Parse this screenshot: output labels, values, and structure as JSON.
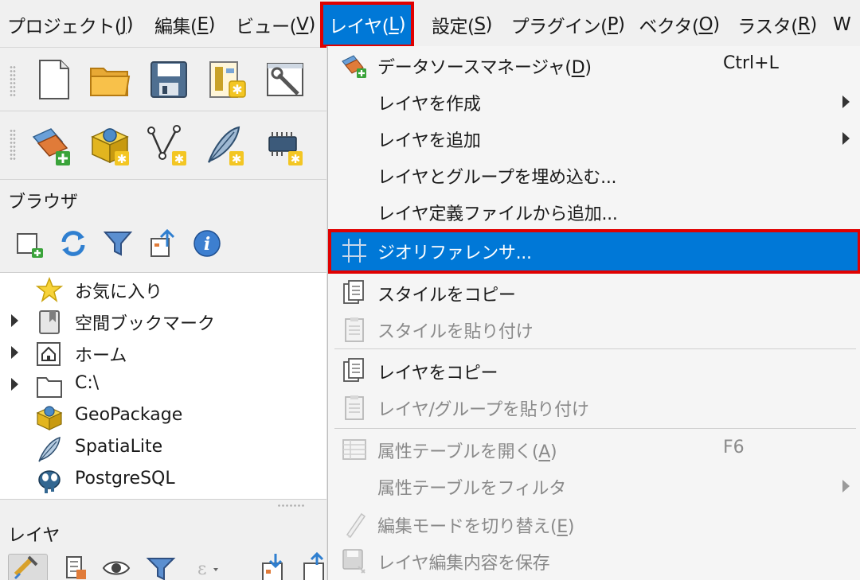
{
  "menubar": {
    "items": [
      {
        "label": "プロジェクト(",
        "accel": "J",
        "close": ")"
      },
      {
        "label": "編集(",
        "accel": "E",
        "close": ")"
      },
      {
        "label": "ビュー(",
        "accel": "V",
        "close": ")"
      },
      {
        "label": "レイヤ(",
        "accel": "L",
        "close": ")"
      },
      {
        "label": "設定(",
        "accel": "S",
        "close": ")"
      },
      {
        "label": "プラグイン(",
        "accel": "P",
        "close": ")"
      },
      {
        "label": "ベクタ(",
        "accel": "O",
        "close": ")"
      },
      {
        "label": "ラスタ(",
        "accel": "R",
        "close": ")"
      },
      {
        "label": "W",
        "accel": "",
        "close": ""
      }
    ],
    "active_index": 3
  },
  "left_panel": {
    "project_toolbar_icons": [
      "new-project-icon",
      "open-project-icon",
      "save-project-icon",
      "new-print-layout-icon",
      "style-manager-icon"
    ],
    "data_toolbar_icons": [
      "data-source-manager-icon",
      "new-geopackage-layer-icon",
      "new-shapefile-layer-icon",
      "new-spatialite-layer-icon",
      "new-temporary-scratch-layer-icon"
    ],
    "browser": {
      "title": "ブラウザ",
      "toolbar_icons": [
        "add-selected-layers-icon",
        "refresh-icon",
        "filter-browser-icon",
        "collapse-all-icon",
        "properties-info-icon"
      ],
      "items": [
        {
          "label": "お気に入り",
          "icon": "star-icon",
          "expandable": false
        },
        {
          "label": "空間ブックマーク",
          "icon": "bookmark-icon",
          "expandable": true
        },
        {
          "label": "ホーム",
          "icon": "home-folder-icon",
          "expandable": true
        },
        {
          "label": "C:\\",
          "icon": "folder-icon",
          "expandable": true
        },
        {
          "label": "GeoPackage",
          "icon": "geopackage-icon",
          "expandable": false
        },
        {
          "label": "SpatiaLite",
          "icon": "spatialite-feather-icon",
          "expandable": false
        },
        {
          "label": "PostgreSQL",
          "icon": "postgresql-elephant-icon",
          "expandable": false
        }
      ]
    },
    "layers": {
      "title": "レイヤ",
      "toolbar_icons": [
        "open-layer-styling-icon",
        "add-group-icon",
        "manage-map-themes-icon",
        "filter-legend-icon",
        "filter-by-expression-icon",
        "expand-all-icon",
        "collapse-all-icon"
      ]
    }
  },
  "dropdown": {
    "items": [
      {
        "label": "データソースマネージャ(",
        "accel": "D",
        "close": ")",
        "shortcut": "Ctrl+L",
        "icon": "data-source-manager-icon",
        "submenu": false,
        "disabled": false
      },
      {
        "label": "レイヤを作成",
        "accel": "",
        "close": "",
        "shortcut": "",
        "icon": "",
        "submenu": true,
        "disabled": false
      },
      {
        "label": "レイヤを追加",
        "accel": "",
        "close": "",
        "shortcut": "",
        "icon": "",
        "submenu": true,
        "disabled": false
      },
      {
        "label": "レイヤとグループを埋め込む...",
        "accel": "",
        "close": "",
        "shortcut": "",
        "icon": "",
        "submenu": false,
        "disabled": false
      },
      {
        "label": "レイヤ定義ファイルから追加...",
        "accel": "",
        "close": "",
        "shortcut": "",
        "icon": "",
        "submenu": false,
        "disabled": false
      },
      {
        "label": "ジオリファレンサ...",
        "accel": "",
        "close": "",
        "shortcut": "",
        "icon": "georeferencer-icon",
        "submenu": false,
        "disabled": false,
        "highlighted": true
      },
      {
        "label": "スタイルをコピー",
        "accel": "",
        "close": "",
        "shortcut": "",
        "icon": "copy-style-icon",
        "submenu": false,
        "disabled": false
      },
      {
        "label": "スタイルを貼り付け",
        "accel": "",
        "close": "",
        "shortcut": "",
        "icon": "paste-style-icon",
        "submenu": false,
        "disabled": true
      },
      {
        "label": "レイヤをコピー",
        "accel": "",
        "close": "",
        "shortcut": "",
        "icon": "copy-layer-icon",
        "submenu": false,
        "disabled": false
      },
      {
        "label": "レイヤ/グループを貼り付け",
        "accel": "",
        "close": "",
        "shortcut": "",
        "icon": "paste-layer-icon",
        "submenu": false,
        "disabled": true
      },
      {
        "label": "属性テーブルを開く(",
        "accel": "A",
        "close": ")",
        "shortcut": "F6",
        "icon": "attribute-table-icon",
        "submenu": false,
        "disabled": true
      },
      {
        "label": "属性テーブルをフィルタ",
        "accel": "",
        "close": "",
        "shortcut": "",
        "icon": "",
        "submenu": true,
        "disabled": true
      },
      {
        "label": "編集モードを切り替え(",
        "accel": "E",
        "close": ")",
        "shortcut": "",
        "icon": "toggle-editing-icon",
        "submenu": false,
        "disabled": true
      },
      {
        "label": "レイヤ編集内容を保存",
        "accel": "",
        "close": "",
        "shortcut": "",
        "icon": "save-layer-edits-icon",
        "submenu": false,
        "disabled": true
      }
    ]
  },
  "colors": {
    "highlight": "#0078d7",
    "emphasis_frame": "#e00000",
    "menubar_bg": "#f0f0f0",
    "disabled_text": "#8a8a8a"
  }
}
